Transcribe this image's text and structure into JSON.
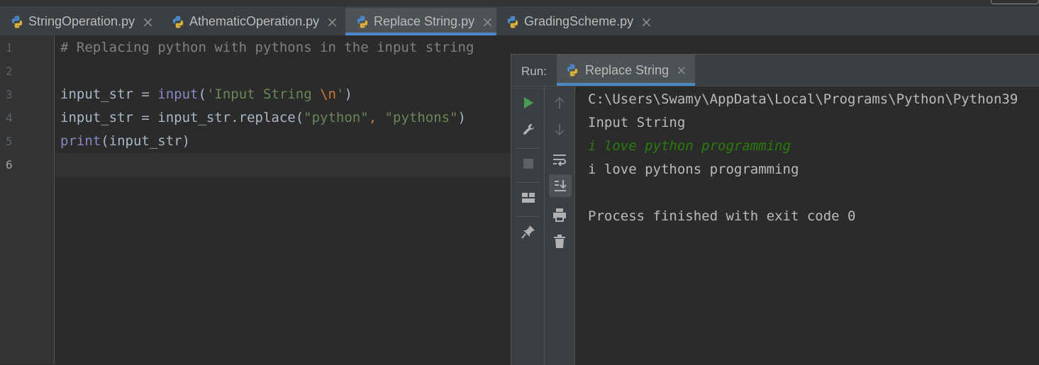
{
  "tabs": [
    {
      "label": "StringOperation.py",
      "active": false
    },
    {
      "label": "AthematicOperation.py",
      "active": false
    },
    {
      "label": "Replace String.py",
      "active": true
    },
    {
      "label": "GradingScheme.py",
      "active": false
    }
  ],
  "editor": {
    "line_numbers": [
      "1",
      "2",
      "3",
      "4",
      "5",
      "6"
    ],
    "current_line": "6",
    "code": {
      "line1_comment": "# Replacing python with pythons in the input string",
      "line3_var": "input_str = ",
      "line3_fn": "input",
      "line3_open": "(",
      "line3_str_a": "'Input String ",
      "line3_esc": "\\n",
      "line3_str_b": "'",
      "line3_close": ")",
      "line4_a": "input_str = input_str.replace(",
      "line4_s1": "\"python\"",
      "line4_comma": ", ",
      "line4_s2": "\"pythons\"",
      "line4_close": ")",
      "line5_fn": "print",
      "line5_rest": "(input_str)"
    }
  },
  "run_panel": {
    "label": "Run:",
    "tab_label": "Replace String",
    "console": {
      "path": "C:\\Users\\Swamy\\AppData\\Local\\Programs\\Python\\Python39",
      "prompt": "Input String",
      "user_input": "i love python programming",
      "output": "i love pythons programming",
      "exit": "Process finished with exit code 0"
    }
  },
  "colors": {
    "background": "#2b2b2b",
    "accent": "#4a88c7",
    "run_green": "#499c54",
    "user_input": "#287d0c"
  },
  "icons": [
    "python-file-icon",
    "close-icon",
    "run-icon",
    "wrench-icon",
    "stop-icon",
    "layout-icon",
    "pin-icon",
    "up-arrow-icon",
    "down-arrow-icon",
    "soft-wrap-icon",
    "scroll-to-end-icon",
    "print-icon",
    "trash-icon"
  ]
}
